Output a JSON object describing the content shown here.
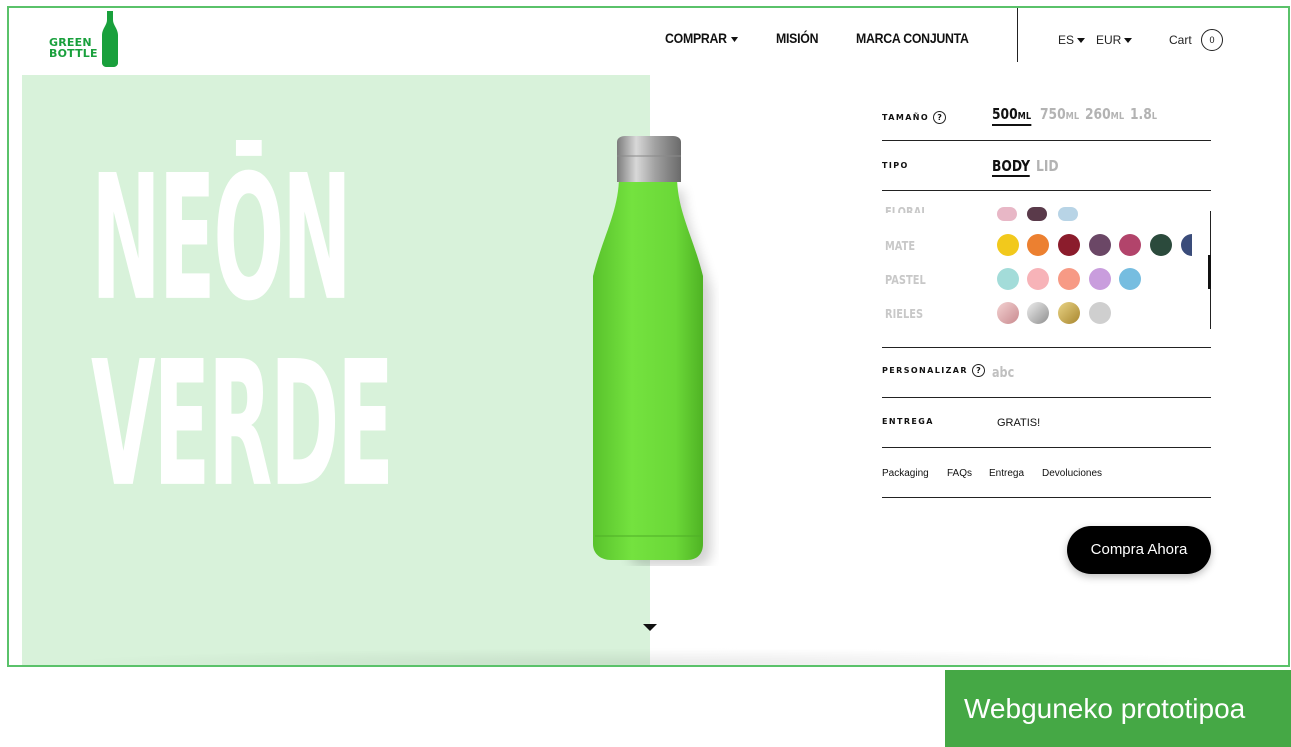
{
  "brand": {
    "line1": "GREEN",
    "line2": "BOTTLE",
    "color": "#19a03c"
  },
  "nav": {
    "comprar": "COMPRAR",
    "mision": "MISIÓN",
    "marca": "MARCA CONJUNTA",
    "language": "ES",
    "currency": "EUR",
    "cart_label": "Cart",
    "cart_count": "0"
  },
  "hero": {
    "line1": "NEŌN",
    "line2": "VERDE",
    "bg_color": "#d8f2da",
    "bottle_color": "#6fdd3e"
  },
  "options": {
    "size_label": "TAMAÑO",
    "help_glyph": "?",
    "sizes": [
      {
        "num": "500",
        "unit": "ML",
        "active": true
      },
      {
        "num": "750",
        "unit": "ML",
        "active": false
      },
      {
        "num": "260",
        "unit": "ML",
        "active": false
      },
      {
        "num": "1.8",
        "unit": "L",
        "active": false
      }
    ],
    "type_label": "TIPO",
    "types": [
      {
        "label": "BODY",
        "active": true
      },
      {
        "label": "LID",
        "active": false
      }
    ],
    "categories": [
      {
        "name": "FLORAL",
        "swatches": [
          "#e8b7c6",
          "#5a3a4a",
          "#b8d4e6"
        ]
      },
      {
        "name": "MATE",
        "swatches": [
          "#f2c91c",
          "#ec8030",
          "#8b1c2c",
          "#6b4766",
          "#b2446b",
          "#2b4a3c",
          "#3a4c7a"
        ]
      },
      {
        "name": "PASTEL",
        "swatches": [
          "#a3dcd9",
          "#f7b3b8",
          "#f79a85",
          "#c99ddd",
          "#76bde0"
        ]
      },
      {
        "name": "RIELES",
        "swatches": [
          "#e2aab0",
          "#b8b8b8",
          "#c9a649",
          "#cfcfcf"
        ]
      }
    ],
    "personalize_label": "PERSONALIZAR",
    "personalize_placeholder": "abc",
    "delivery_label": "ENTREGA",
    "delivery_value": "GRATIS!",
    "links": [
      "Packaging",
      "FAQs",
      "Entrega",
      "Devoluciones"
    ],
    "buy_button": "Compra Ahora"
  },
  "caption": "Webguneko prototipoa",
  "colors": {
    "frame": "#5ac26a",
    "caption_bg": "#45a845"
  }
}
